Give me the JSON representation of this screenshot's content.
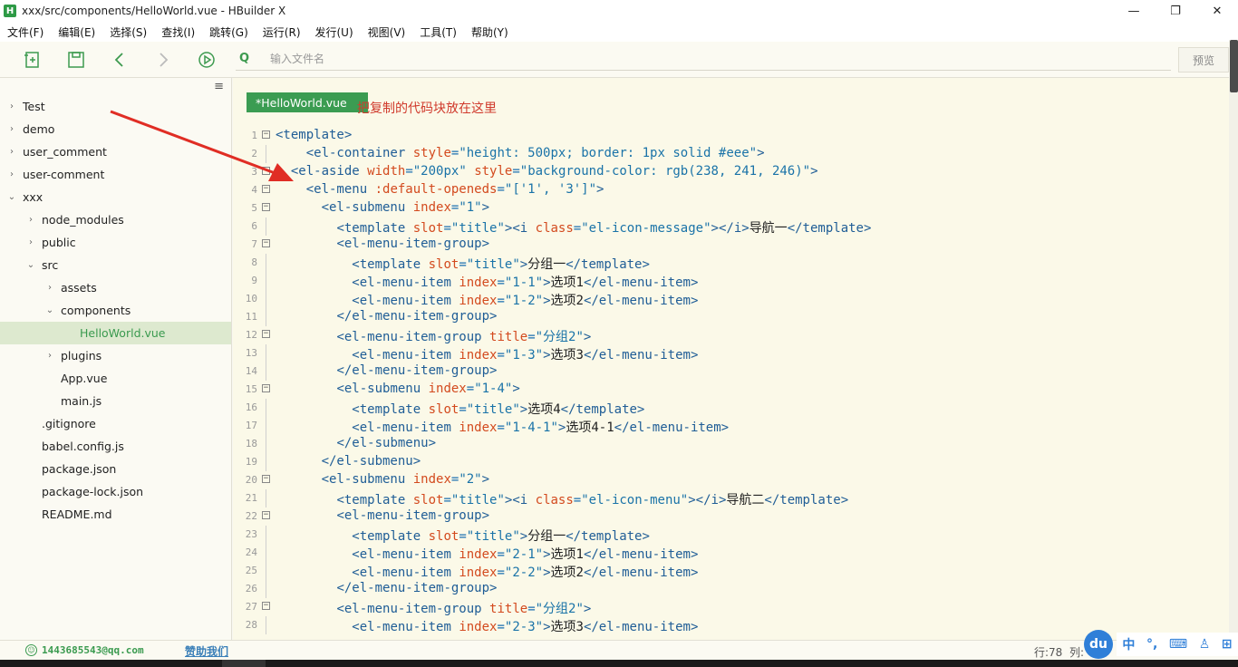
{
  "window": {
    "title": "xxx/src/components/HelloWorld.vue - HBuilder X",
    "logo": "H",
    "minimize": "—",
    "restore": "❐",
    "close": "✕"
  },
  "menu": [
    "文件(F)",
    "编辑(E)",
    "选择(S)",
    "查找(I)",
    "跳转(G)",
    "运行(R)",
    "发行(U)",
    "视图(V)",
    "工具(T)",
    "帮助(Y)"
  ],
  "toolbar": {
    "search_icon": "Q",
    "search_placeholder": "输入文件名",
    "preview_label": "预览"
  },
  "sidebar": {
    "menu_icon": "≡",
    "items": [
      {
        "label": "Test",
        "depth": 0,
        "chevron": "›"
      },
      {
        "label": "demo",
        "depth": 0,
        "chevron": "›"
      },
      {
        "label": "user_comment",
        "depth": 0,
        "chevron": "›"
      },
      {
        "label": "user-comment",
        "depth": 0,
        "chevron": "›"
      },
      {
        "label": "xxx",
        "depth": 0,
        "chevron": "⌄"
      },
      {
        "label": "node_modules",
        "depth": 1,
        "chevron": "›"
      },
      {
        "label": "public",
        "depth": 1,
        "chevron": "›"
      },
      {
        "label": "src",
        "depth": 1,
        "chevron": "⌄"
      },
      {
        "label": "assets",
        "depth": 2,
        "chevron": "›"
      },
      {
        "label": "components",
        "depth": 2,
        "chevron": "⌄"
      },
      {
        "label": "HelloWorld.vue",
        "depth": 3,
        "chevron": "",
        "selected": true
      },
      {
        "label": "plugins",
        "depth": 2,
        "chevron": "›"
      },
      {
        "label": "App.vue",
        "depth": 2,
        "chevron": ""
      },
      {
        "label": "main.js",
        "depth": 2,
        "chevron": ""
      },
      {
        "label": ".gitignore",
        "depth": 1,
        "chevron": ""
      },
      {
        "label": "babel.config.js",
        "depth": 1,
        "chevron": ""
      },
      {
        "label": "package.json",
        "depth": 1,
        "chevron": ""
      },
      {
        "label": "package-lock.json",
        "depth": 1,
        "chevron": ""
      },
      {
        "label": "README.md",
        "depth": 1,
        "chevron": ""
      }
    ]
  },
  "editor": {
    "tab_label": "*HelloWorld.vue",
    "annotation": "把复制的代码块放在这里",
    "lines": [
      {
        "n": "1",
        "fold": true,
        "html": "<span class=\"t\">&lt;template&gt;</span>"
      },
      {
        "n": "2",
        "fold": false,
        "html": "    <span class=\"t\">&lt;el-container</span> <span class=\"a\">style</span>=<span class=\"s\">\"height: 500px; border: 1px solid #eee\"</span><span class=\"t\">&gt;</span>"
      },
      {
        "n": "3",
        "fold": true,
        "html": "  <span class=\"t\">&lt;el-aside</span> <span class=\"a\">width</span>=<span class=\"s\">\"200px\"</span> <span class=\"a\">style</span>=<span class=\"s\">\"background-color: rgb(238, 241, 246)\"</span><span class=\"t\">&gt;</span>"
      },
      {
        "n": "4",
        "fold": true,
        "html": "    <span class=\"t\">&lt;el-menu</span> <span class=\"a\">:default-openeds</span>=<span class=\"s\">\"['1', '3']\"</span><span class=\"t\">&gt;</span>"
      },
      {
        "n": "5",
        "fold": true,
        "html": "      <span class=\"t\">&lt;el-submenu</span> <span class=\"a\">index</span>=<span class=\"s\">\"1\"</span><span class=\"t\">&gt;</span>"
      },
      {
        "n": "6",
        "fold": false,
        "html": "        <span class=\"t\">&lt;template</span> <span class=\"a\">slot</span>=<span class=\"s\">\"title\"</span><span class=\"t\">&gt;&lt;i</span> <span class=\"a\">class</span>=<span class=\"s\">\"el-icon-message\"</span><span class=\"t\">&gt;&lt;/i&gt;</span><span class=\"x\">导航一</span><span class=\"t\">&lt;/template&gt;</span>"
      },
      {
        "n": "7",
        "fold": true,
        "html": "        <span class=\"t\">&lt;el-menu-item-group&gt;</span>"
      },
      {
        "n": "8",
        "fold": false,
        "html": "          <span class=\"t\">&lt;template</span> <span class=\"a\">slot</span>=<span class=\"s\">\"title\"</span><span class=\"t\">&gt;</span><span class=\"x\">分组一</span><span class=\"t\">&lt;/template&gt;</span>"
      },
      {
        "n": "9",
        "fold": false,
        "html": "          <span class=\"t\">&lt;el-menu-item</span> <span class=\"a\">index</span>=<span class=\"s\">\"1-1\"</span><span class=\"t\">&gt;</span><span class=\"x\">选项1</span><span class=\"t\">&lt;/el-menu-item&gt;</span>"
      },
      {
        "n": "10",
        "fold": false,
        "html": "          <span class=\"t\">&lt;el-menu-item</span> <span class=\"a\">index</span>=<span class=\"s\">\"1-2\"</span><span class=\"t\">&gt;</span><span class=\"x\">选项2</span><span class=\"t\">&lt;/el-menu-item&gt;</span>"
      },
      {
        "n": "11",
        "fold": false,
        "html": "        <span class=\"t\">&lt;/el-menu-item-group&gt;</span>"
      },
      {
        "n": "12",
        "fold": true,
        "html": "        <span class=\"t\">&lt;el-menu-item-group</span> <span class=\"a\">title</span>=<span class=\"s\">\"分组2\"</span><span class=\"t\">&gt;</span>"
      },
      {
        "n": "13",
        "fold": false,
        "html": "          <span class=\"t\">&lt;el-menu-item</span> <span class=\"a\">index</span>=<span class=\"s\">\"1-3\"</span><span class=\"t\">&gt;</span><span class=\"x\">选项3</span><span class=\"t\">&lt;/el-menu-item&gt;</span>"
      },
      {
        "n": "14",
        "fold": false,
        "html": "        <span class=\"t\">&lt;/el-menu-item-group&gt;</span>"
      },
      {
        "n": "15",
        "fold": true,
        "html": "        <span class=\"t\">&lt;el-submenu</span> <span class=\"a\">index</span>=<span class=\"s\">\"1-4\"</span><span class=\"t\">&gt;</span>"
      },
      {
        "n": "16",
        "fold": false,
        "html": "          <span class=\"t\">&lt;template</span> <span class=\"a\">slot</span>=<span class=\"s\">\"title\"</span><span class=\"t\">&gt;</span><span class=\"x\">选项4</span><span class=\"t\">&lt;/template&gt;</span>"
      },
      {
        "n": "17",
        "fold": false,
        "html": "          <span class=\"t\">&lt;el-menu-item</span> <span class=\"a\">index</span>=<span class=\"s\">\"1-4-1\"</span><span class=\"t\">&gt;</span><span class=\"x\">选项4-1</span><span class=\"t\">&lt;/el-menu-item&gt;</span>"
      },
      {
        "n": "18",
        "fold": false,
        "html": "        <span class=\"t\">&lt;/el-submenu&gt;</span>"
      },
      {
        "n": "19",
        "fold": false,
        "html": "      <span class=\"t\">&lt;/el-submenu&gt;</span>"
      },
      {
        "n": "20",
        "fold": true,
        "html": "      <span class=\"t\">&lt;el-submenu</span> <span class=\"a\">index</span>=<span class=\"s\">\"2\"</span><span class=\"t\">&gt;</span>"
      },
      {
        "n": "21",
        "fold": false,
        "html": "        <span class=\"t\">&lt;template</span> <span class=\"a\">slot</span>=<span class=\"s\">\"title\"</span><span class=\"t\">&gt;&lt;i</span> <span class=\"a\">class</span>=<span class=\"s\">\"el-icon-menu\"</span><span class=\"t\">&gt;&lt;/i&gt;</span><span class=\"x\">导航二</span><span class=\"t\">&lt;/template&gt;</span>"
      },
      {
        "n": "22",
        "fold": true,
        "html": "        <span class=\"t\">&lt;el-menu-item-group&gt;</span>"
      },
      {
        "n": "23",
        "fold": false,
        "html": "          <span class=\"t\">&lt;template</span> <span class=\"a\">slot</span>=<span class=\"s\">\"title\"</span><span class=\"t\">&gt;</span><span class=\"x\">分组一</span><span class=\"t\">&lt;/template&gt;</span>"
      },
      {
        "n": "24",
        "fold": false,
        "html": "          <span class=\"t\">&lt;el-menu-item</span> <span class=\"a\">index</span>=<span class=\"s\">\"2-1\"</span><span class=\"t\">&gt;</span><span class=\"x\">选项1</span><span class=\"t\">&lt;/el-menu-item&gt;</span>"
      },
      {
        "n": "25",
        "fold": false,
        "html": "          <span class=\"t\">&lt;el-menu-item</span> <span class=\"a\">index</span>=<span class=\"s\">\"2-2\"</span><span class=\"t\">&gt;</span><span class=\"x\">选项2</span><span class=\"t\">&lt;/el-menu-item&gt;</span>"
      },
      {
        "n": "26",
        "fold": false,
        "html": "        <span class=\"t\">&lt;/el-menu-item-group&gt;</span>"
      },
      {
        "n": "27",
        "fold": true,
        "html": "        <span class=\"t\">&lt;el-menu-item-group</span> <span class=\"a\">title</span>=<span class=\"s\">\"分组2\"</span><span class=\"t\">&gt;</span>"
      },
      {
        "n": "28",
        "fold": false,
        "html": "          <span class=\"t\">&lt;el-menu-item</span> <span class=\"a\">index</span>=<span class=\"s\">\"2-3\"</span><span class=\"t\">&gt;</span><span class=\"x\">选项3</span><span class=\"t\">&lt;/el-menu-item&gt;</span>"
      }
    ]
  },
  "status": {
    "user_icon": "☺",
    "user": "1443685543@qq.com",
    "donate": "赞助我们",
    "row": "行:78",
    "col": "列:"
  },
  "ime": {
    "logo": "du",
    "lang": "中",
    "punct": "°,",
    "keyboard": "⌨",
    "user": "♙",
    "grid": "⊞"
  },
  "colors": {
    "accent": "#3b9c52",
    "annotation": "#d03a2c",
    "editor_bg": "#fbf9e8"
  }
}
